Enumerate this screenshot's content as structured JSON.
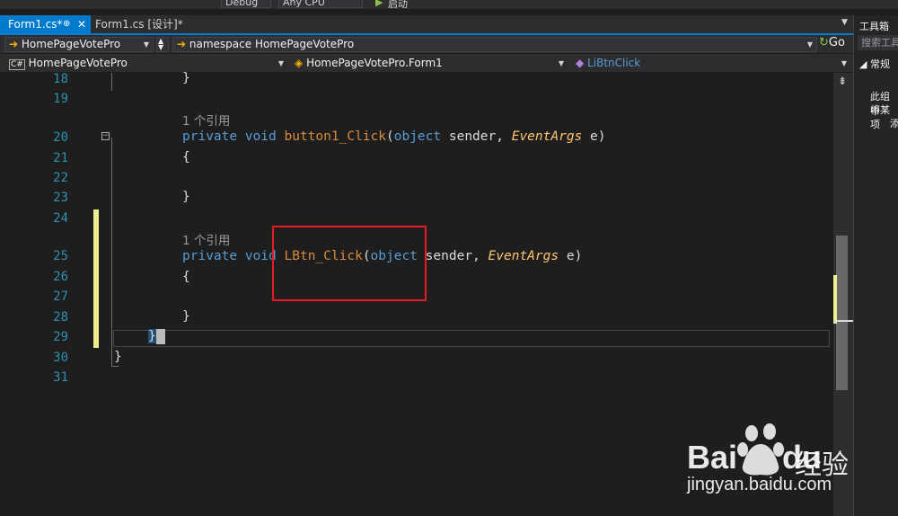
{
  "toolbar": {
    "config": "Debug",
    "platform": "Any CPU",
    "start_label": "启动"
  },
  "tabs": [
    {
      "label": "Form1.cs*",
      "pin": "⊕",
      "close": "✕"
    },
    {
      "label": "Form1.cs [设计]*"
    }
  ],
  "nav1": {
    "project": "HomePageVotePro",
    "namespace_label": "namespace HomePageVotePro",
    "go_label": "Go"
  },
  "nav2": {
    "project": "HomePageVotePro",
    "class": "HomePageVotePro.Form1",
    "member": "LiBtnClick"
  },
  "toolbox": {
    "title": "工具箱",
    "search_placeholder": "搜索工具",
    "section": "常规",
    "empty_l1": "此组中",
    "empty_l2": "将某项",
    "empty_l3": "添"
  },
  "editor": {
    "line_numbers": [
      "18",
      "19",
      "20",
      "21",
      "22",
      "23",
      "24",
      "25",
      "26",
      "27",
      "28",
      "29",
      "30",
      "31"
    ],
    "ref_text": "1 个引用",
    "kw_private": "private",
    "kw_void": "void",
    "kw_object": "object",
    "param_sender": "sender",
    "type_eventargs": "EventArgs",
    "param_e": "e",
    "method1": "button1_Click",
    "method2": "LBtn_Click",
    "brace_open": "{",
    "brace_close": "}"
  },
  "watermark": {
    "brand": "Bai",
    "brand2": "du",
    "jingyan": "经验",
    "url": "jingyan.baidu.com"
  },
  "colors": {
    "accent": "#007acc",
    "highlight_box": "#e51c23",
    "change_marker": "#efef91"
  }
}
